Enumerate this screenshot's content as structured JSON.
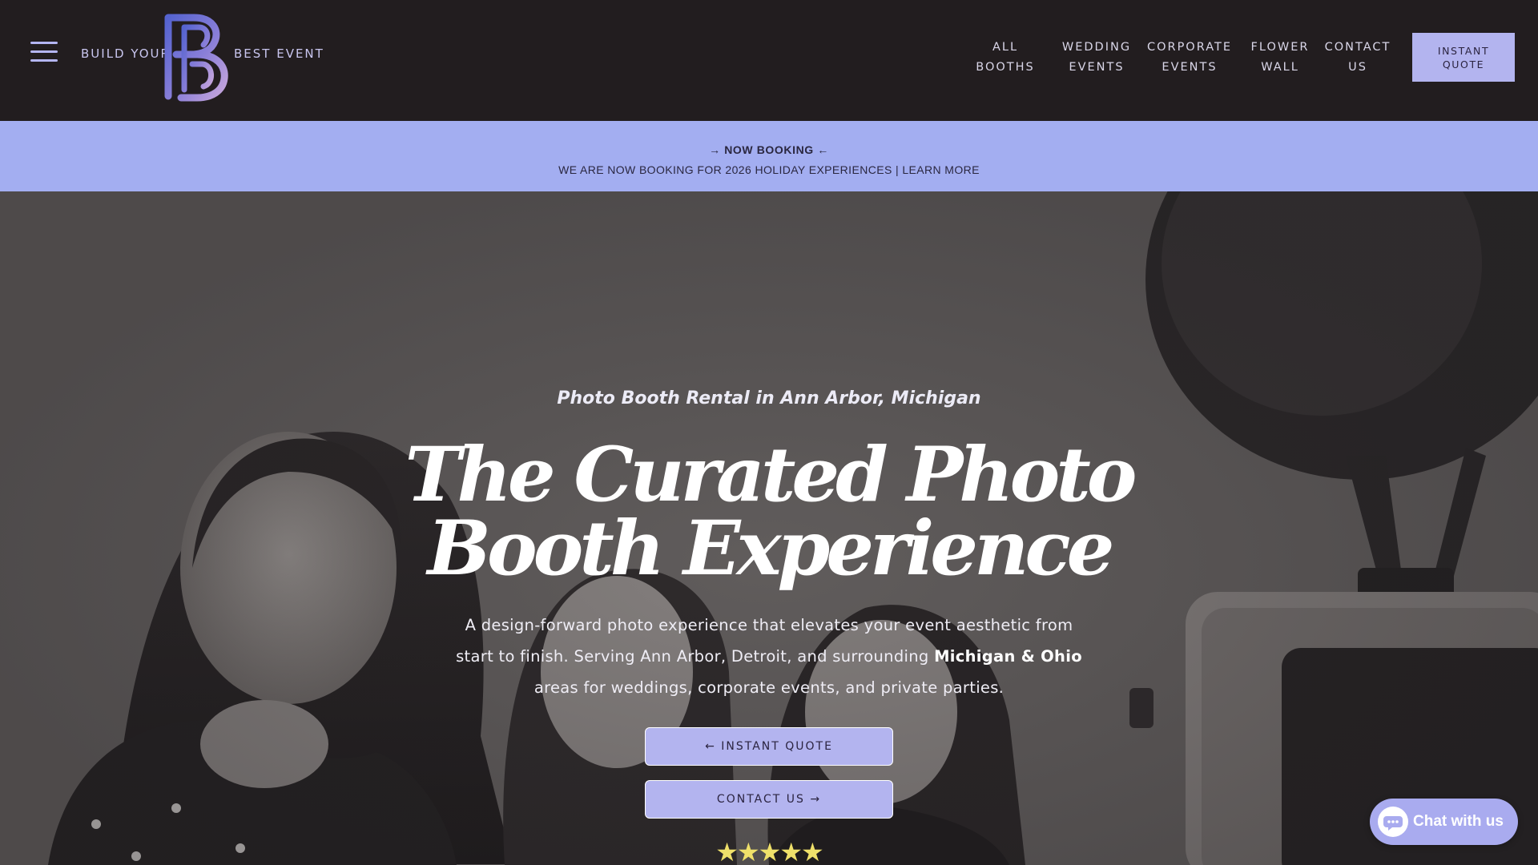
{
  "header": {
    "brand_left": "BUILD YOUR",
    "brand_right": "BEST EVENT",
    "nav": [
      {
        "line1": "ALL",
        "line2": "BOOTHS"
      },
      {
        "line1": "WEDDING",
        "line2": "EVENTS"
      },
      {
        "line1": "CORPORATE",
        "line2": "EVENTS"
      },
      {
        "line1": "FLOWER",
        "line2": "WALL"
      },
      {
        "line1": "CONTACT",
        "line2": "US"
      }
    ],
    "quote_button": {
      "line1": "INSTANT",
      "line2": "QUOTE"
    }
  },
  "banner": {
    "title": "→ NOW BOOKING ←",
    "text": "WE ARE NOW BOOKING FOR 2026 HOLIDAY EXPERIENCES | LEARN MORE"
  },
  "hero": {
    "subtitle": "Photo Booth Rental in Ann Arbor, Michigan",
    "headline_line1": "The Curated Photo",
    "headline_line2": "Booth Experience",
    "description_before": "A design-forward photo experience that elevates your event aesthetic from start to finish. Serving Ann Arbor, Detroit, and surrounding ",
    "description_bold": "Michigan & Ohio",
    "description_after": " areas for weddings, corporate events, and private parties.",
    "cta_quote": "← INSTANT QUOTE",
    "cta_contact": "CONTACT US →",
    "rating_stars": 5,
    "stars_text": "★★★★★"
  },
  "chat": {
    "label": "Chat with us"
  },
  "colors": {
    "header_bg": "#221d1f",
    "accent_lavender": "#b3b4ef",
    "banner_bg": "#a3aef1",
    "star_yellow": "#efe06a"
  },
  "icons": [
    "hamburger-menu-icon",
    "bb-monogram-logo",
    "star-icon",
    "chat-bubble-icon"
  ]
}
